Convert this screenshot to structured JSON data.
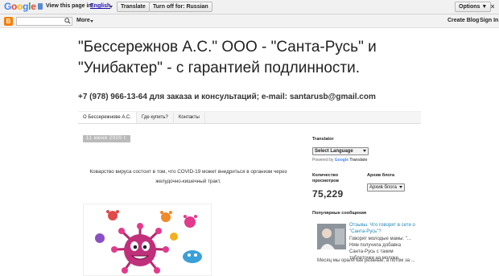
{
  "translate_bar": {
    "logo": [
      "G",
      "o",
      "o",
      "g",
      "l",
      "e"
    ],
    "view_prefix": "View this page in:",
    "language": "English",
    "translate_label": "Translate",
    "turn_off_label": "Turn off for: Russian",
    "options_label": "Options ▼",
    "close_glyph": "×"
  },
  "navbar": {
    "logo_letter": "B",
    "more_label": "More",
    "create_blog_label": "Create Blog",
    "sign_in_label": "Sign In"
  },
  "header": {
    "title": "\"Бессережнов А.С.\" ООО - \"Санта-Русь\" и \"Унибактер\" - с гарантией подлинности.",
    "description": "+7 (978) 966-13-64 для заказа и консультаций; e-mail: santarusb@gmail.com"
  },
  "tabs": [
    {
      "label": "О Бессережнове А.С."
    },
    {
      "label": "Где купить?"
    },
    {
      "label": "Контакты"
    }
  ],
  "post": {
    "date": "11 июня 2020 г.",
    "text": "Коварство вируса состоит в том, что COVID-19 может внедриться в организм через желудочно-кишечный тракт."
  },
  "sidebar": {
    "translator_heading": "Translator",
    "language_select": "Select Language",
    "powered_by": "Powered by",
    "powered_brand": "Google",
    "powered_suffix": "Translate",
    "views_heading": "Количество просмотров",
    "views_count": "75,229",
    "archive_heading": "Архив блога",
    "archive_select": "Архив блога",
    "popular_heading": "Популярные сообщения",
    "popular_title": "Отзывы. Что говорят в сети о \"Санта-Русь\"?",
    "popular_snippet": "Говорят молодые мамы: \"... Ням получила добавка Санта-Русь с таким таблеточки на молоке.",
    "popular_snippet2": "Месяц мы орали как резаные, а потом за ..."
  },
  "colors": {
    "link_blue": "#2288bb",
    "blogger_orange": "#f57d00",
    "virus_magenta": "#c0307a"
  }
}
